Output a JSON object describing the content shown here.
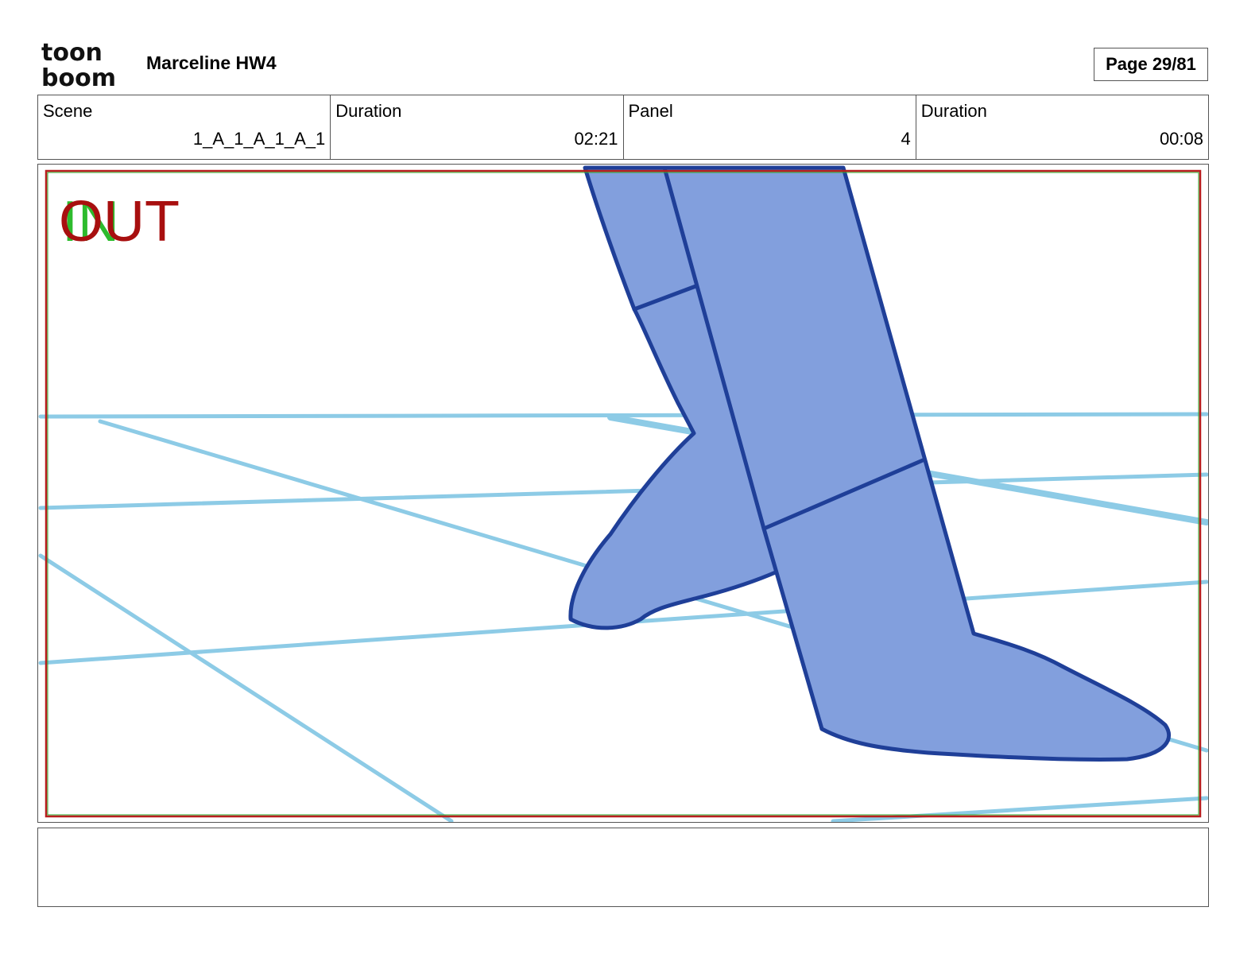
{
  "header": {
    "project_title": "Marceline HW4",
    "page_label": "Page 29/81"
  },
  "logo": {
    "line1": "toon",
    "line2": "boom"
  },
  "info": {
    "scene_label": "Scene",
    "scene_value": "1_A_1_A_1_A_1",
    "scene_duration_label": "Duration",
    "scene_duration_value": "02:21",
    "panel_label": "Panel",
    "panel_value": "4",
    "panel_duration_label": "Duration",
    "panel_duration_value": "00:08"
  },
  "panel": {
    "in_text": "IN",
    "out_text": "OUT",
    "colors": {
      "in": "#2dbb2d",
      "out": "#a80f0f",
      "guide_lines": "#8dcbe6",
      "leg_fill": "#829fdd",
      "leg_stroke": "#1f3f98"
    }
  },
  "notes": {
    "text": ""
  }
}
